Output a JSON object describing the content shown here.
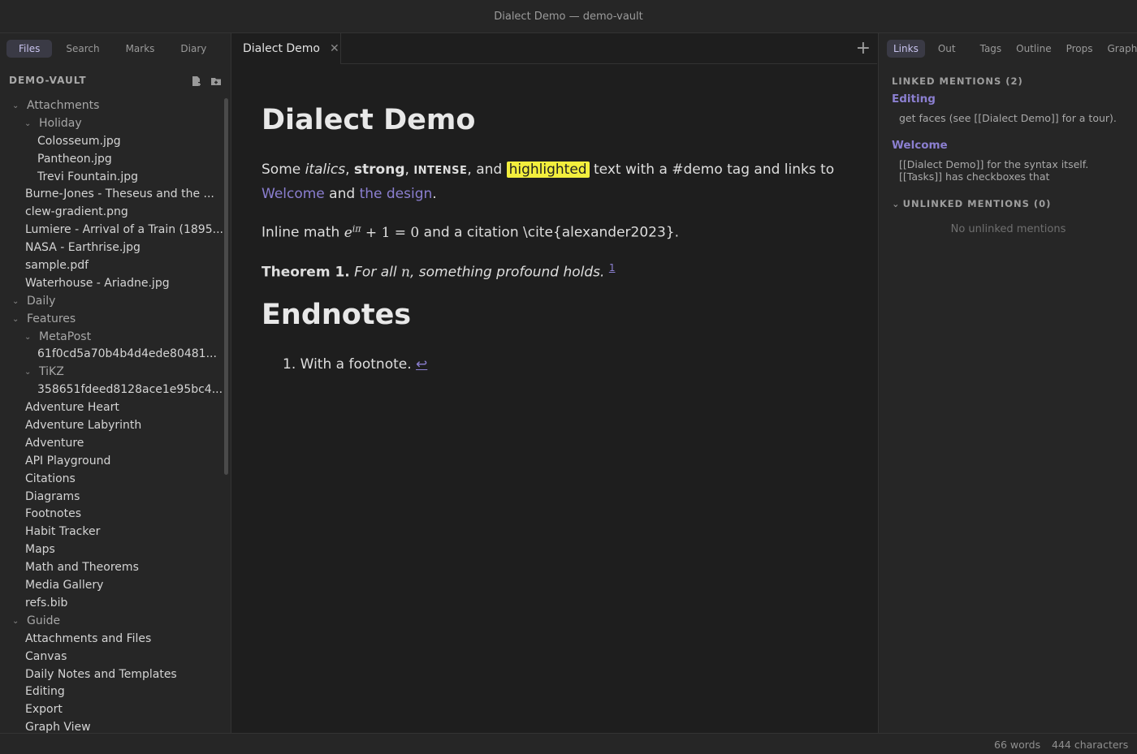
{
  "window": {
    "title": "Dialect Demo — demo-vault"
  },
  "left": {
    "tabs": [
      "Files",
      "Search",
      "Marks",
      "Diary"
    ],
    "vault_name": "DEMO-VAULT",
    "icons": [
      "new-note-icon",
      "new-folder-icon"
    ],
    "tree": [
      {
        "label": "Attachments",
        "folder": true,
        "depth": 0
      },
      {
        "label": "Holiday",
        "folder": true,
        "depth": 1
      },
      {
        "label": "Colosseum.jpg",
        "depth": 2
      },
      {
        "label": "Pantheon.jpg",
        "depth": 2
      },
      {
        "label": "Trevi Fountain.jpg",
        "depth": 2
      },
      {
        "label": "Burne-Jones - Theseus and the ...",
        "depth": 1
      },
      {
        "label": "clew-gradient.png",
        "depth": 1
      },
      {
        "label": "Lumiere - Arrival of a Train (1895...",
        "depth": 1
      },
      {
        "label": "NASA - Earthrise.jpg",
        "depth": 1
      },
      {
        "label": "sample.pdf",
        "depth": 1
      },
      {
        "label": "Waterhouse - Ariadne.jpg",
        "depth": 1
      },
      {
        "label": "Daily",
        "folder": true,
        "depth": 0
      },
      {
        "label": "Features",
        "folder": true,
        "depth": 0
      },
      {
        "label": "MetaPost",
        "folder": true,
        "depth": 1
      },
      {
        "label": "61f0cd5a70b4b4d4ede80481...",
        "depth": 2
      },
      {
        "label": "TiKZ",
        "folder": true,
        "depth": 1
      },
      {
        "label": "358651fdeed8128ace1e95bc4...",
        "depth": 2
      },
      {
        "label": "Adventure Heart",
        "depth": 1
      },
      {
        "label": "Adventure Labyrinth",
        "depth": 1
      },
      {
        "label": "Adventure",
        "depth": 1
      },
      {
        "label": "API Playground",
        "depth": 1
      },
      {
        "label": "Citations",
        "depth": 1
      },
      {
        "label": "Diagrams",
        "depth": 1
      },
      {
        "label": "Footnotes",
        "depth": 1
      },
      {
        "label": "Habit Tracker",
        "depth": 1
      },
      {
        "label": "Maps",
        "depth": 1
      },
      {
        "label": "Math and Theorems",
        "depth": 1
      },
      {
        "label": "Media Gallery",
        "depth": 1
      },
      {
        "label": "refs.bib",
        "depth": 1
      },
      {
        "label": "Guide",
        "folder": true,
        "depth": 0
      },
      {
        "label": "Attachments and Files",
        "depth": 1
      },
      {
        "label": "Canvas",
        "depth": 1
      },
      {
        "label": "Daily Notes and Templates",
        "depth": 1
      },
      {
        "label": "Editing",
        "depth": 1
      },
      {
        "label": "Export",
        "depth": 1
      },
      {
        "label": "Graph View",
        "depth": 1
      }
    ]
  },
  "editor": {
    "tab_label": "Dialect Demo",
    "close_glyph": "✕",
    "new_tab_glyph": "+",
    "heading": "Dialect Demo",
    "para1": {
      "t1": "Some ",
      "italic": "italics",
      "t2": ", ",
      "strong": "strong",
      "t3": ", ",
      "intense": "INTENSE",
      "t4": ", and ",
      "highlight": "highlighted",
      "t5": " text with a #demo tag and links to",
      "link1": "Welcome",
      "t6": " and ",
      "link2": "the design",
      "t7": "."
    },
    "para2": {
      "t1": "Inline math ",
      "math_base": "e",
      "math_sup": "iπ",
      "math_rest": " + 1 = 0",
      "t2": " and a citation \\cite{alexander2023}."
    },
    "theorem": {
      "label": "Theorem 1.",
      "t1": " For all ",
      "var": "n",
      "t2": ", something profound holds.",
      "footnote_ref": "1"
    },
    "endnotes_heading": "Endnotes",
    "endnote": {
      "number": "1.",
      "text": "With a footnote.",
      "back": "↩"
    }
  },
  "right": {
    "tabs": [
      "Links",
      "Out",
      "Tags",
      "Outline",
      "Props",
      "Graph"
    ],
    "linked_header": "LINKED MENTIONS (2)",
    "mentions": [
      {
        "title": "Editing",
        "lines": [
          "get faces (see [[Dialect Demo]] for a tour)."
        ]
      },
      {
        "title": "Welcome",
        "lines": [
          "[[Dialect Demo]] for the syntax itself.",
          "[[Tasks]] has checkboxes that"
        ]
      }
    ],
    "unlinked_header": "UNLINKED MENTIONS (0)",
    "no_unlinked": "No unlinked mentions"
  },
  "status": {
    "words": "66 words",
    "chars": "444 characters"
  },
  "colors": {
    "accent": "#8b7fd0",
    "highlight": "#f2ee3d",
    "bg": "#1e1e1e",
    "panel": "#262626"
  }
}
